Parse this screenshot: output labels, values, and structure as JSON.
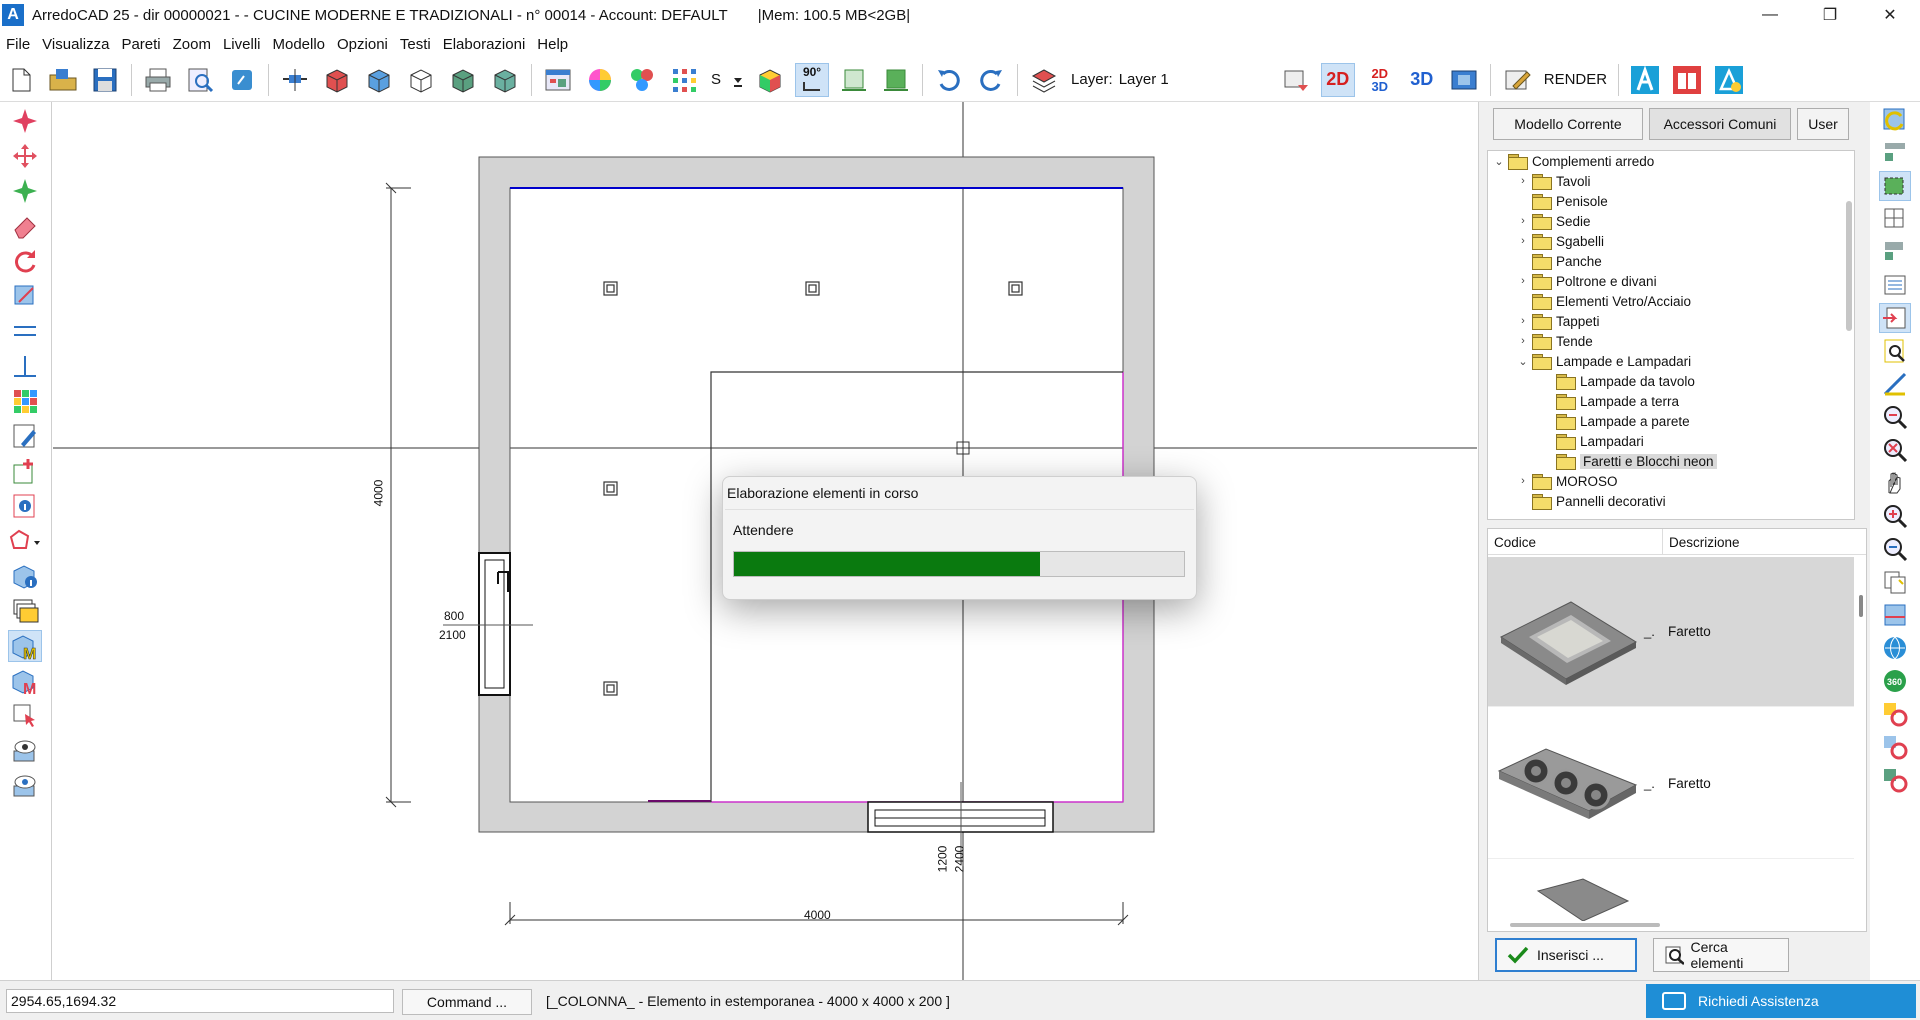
{
  "window": {
    "title": "ArredoCAD 25 - dir 00000021 -  - CUCINE MODERNE E TRADIZIONALI - n° 00014 - Account: DEFAULT",
    "mem": "|Mem: 100.5 MB<2GB|",
    "app_icon_letter": "A",
    "minimize": "—",
    "restore": "❐",
    "close": "✕"
  },
  "menu": [
    "File",
    "Visualizza",
    "Pareti",
    "Zoom",
    "Livelli",
    "Modello",
    "Opzioni",
    "Testi",
    "Elaborazioni",
    "Help"
  ],
  "toolbar": {
    "s_label": "S",
    "angle_label": "90°",
    "layer_label": "Layer:",
    "layer_value": "Layer 1",
    "view_2d": "2D",
    "view_2d3d_top": "2D",
    "view_2d3d_bottom": "3D",
    "view_3d": "3D",
    "render_label": "RENDER"
  },
  "drawing": {
    "dim_left": "4000",
    "dim_bottom": "4000",
    "door_width": "800",
    "door_height": "2100",
    "window_width": "1200",
    "window_height": "2400"
  },
  "dialog": {
    "title": "Elaborazione elementi in corso",
    "message": "Attendere",
    "progress": 0.68
  },
  "right_panel": {
    "tabs": [
      "Modello Corrente",
      "Accessori Comuni",
      "User"
    ],
    "selected_tab": "Accessori Comuni",
    "tree": [
      {
        "label": "Complementi arredo",
        "level": 0,
        "toggle": "v"
      },
      {
        "label": "Tavoli",
        "level": 1,
        "toggle": ">"
      },
      {
        "label": "Penisole",
        "level": 1,
        "toggle": ""
      },
      {
        "label": "Sedie",
        "level": 1,
        "toggle": ">"
      },
      {
        "label": "Sgabelli",
        "level": 1,
        "toggle": ">"
      },
      {
        "label": "Panche",
        "level": 1,
        "toggle": ""
      },
      {
        "label": "Poltrone e divani",
        "level": 1,
        "toggle": ">"
      },
      {
        "label": "Elementi Vetro/Acciaio",
        "level": 1,
        "toggle": ""
      },
      {
        "label": "Tappeti",
        "level": 1,
        "toggle": ">"
      },
      {
        "label": "Tende",
        "level": 1,
        "toggle": ">"
      },
      {
        "label": "Lampade e Lampadari",
        "level": 1,
        "toggle": "v"
      },
      {
        "label": "Lampade da tavolo",
        "level": 2,
        "toggle": ""
      },
      {
        "label": "Lampade a terra",
        "level": 2,
        "toggle": ""
      },
      {
        "label": "Lampade a parete",
        "level": 2,
        "toggle": ""
      },
      {
        "label": "Lampadari",
        "level": 2,
        "toggle": ""
      },
      {
        "label": "Faretti e Blocchi neon",
        "level": 2,
        "toggle": "",
        "selected": true
      },
      {
        "label": "MOROSO",
        "level": 1,
        "toggle": ">"
      },
      {
        "label": "Pannelli decorativi",
        "level": 1,
        "toggle": ""
      }
    ],
    "grid_headers": [
      "Codice",
      "Descrizione"
    ],
    "grid_rows": [
      {
        "code": "_.",
        "description": "Faretto",
        "selected": true
      },
      {
        "code": "_.",
        "description": "Faretto",
        "selected": false
      }
    ],
    "insert_button": "Inserisci ...",
    "search_button": "Cerca elementi"
  },
  "status": {
    "coords": "2954.65,1694.32",
    "command_button": "Command ...",
    "message": "[_COLONNA_ - Elemento in estemporanea - 4000 x 4000 x 200 ]",
    "assist_button": "Richiedi Assistenza"
  },
  "colors": {
    "accent": "#1f8ed6",
    "progress_fill": "#0a7a0f",
    "wall_fill": "#d3d3d3",
    "wall_blue_edge": "#0000cc",
    "wall_magenta_edge": "#cc33cc",
    "view_2d": "#d62020",
    "view_3d": "#2060d0"
  },
  "icons": {
    "left_toolbar": [
      "pointer-star-icon",
      "move-icon",
      "explode-icon",
      "eraser-icon",
      "rotate-icon",
      "mirror-icon",
      "parallel-line-icon",
      "perpendicular-icon",
      "color-grid-icon",
      "edit-tools-icon",
      "add-node-icon",
      "info-icon",
      "polygon-icon",
      "model-info-icon",
      "layers-icon",
      "model-m-icon",
      "model-m-red-icon",
      "select-arrow-icon",
      "view-eye-icon",
      "view-eye-2-icon"
    ],
    "right_toolbar": [
      "refresh-icon",
      "table-view-icon",
      "select-rect-icon",
      "grid-plus-icon",
      "grid-arrow-icon",
      "list-icon",
      "import-icon",
      "search-doc-icon",
      "measure-icon",
      "zoom-area-icon",
      "zoom-extents-icon",
      "pan-hand-icon",
      "zoom-in-icon",
      "zoom-out-icon",
      "copy-icon",
      "cross-section-icon",
      "globe-icon",
      "view-360-icon",
      "color-c-icon",
      "color-c-2-icon",
      "color-c-3-icon"
    ]
  }
}
